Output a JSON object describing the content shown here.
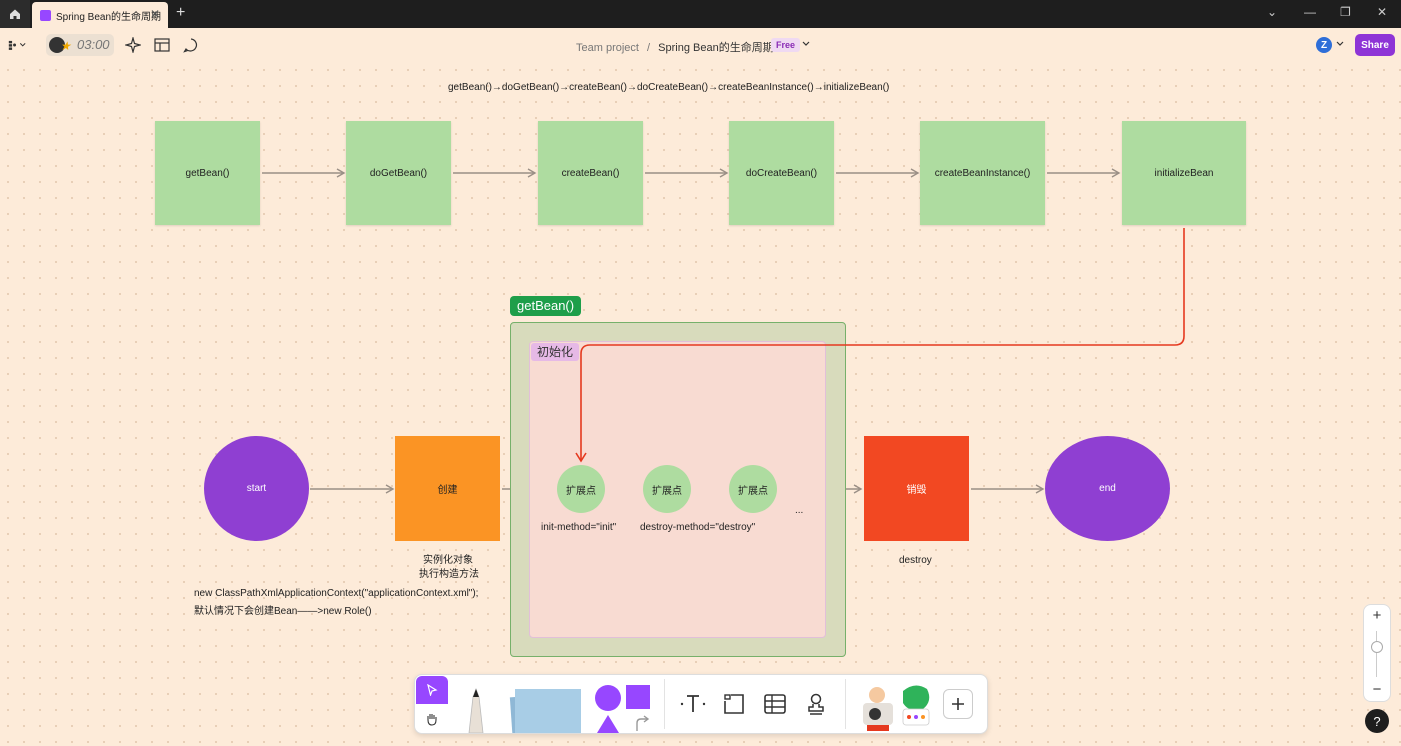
{
  "window": {
    "tab_title": "Spring Bean的生命周期",
    "tab_close": "✕",
    "new_tab": "+",
    "controls": [
      "⌄",
      "—",
      "❐",
      "✕"
    ]
  },
  "toolbar": {
    "timer": "03:00",
    "breadcrumb_team": "Team project",
    "breadcrumb_sep": "/",
    "file_name": "Spring Bean的生命周期",
    "plan_badge": "Free",
    "user_initial": "Z",
    "share_label": "Share"
  },
  "canvas": {
    "chain_text": "getBean()→doGetBean()→createBean()→doCreateBean()→createBeanInstance()→initializeBean()",
    "top_flow": [
      "getBean()",
      "doGetBean()",
      "createBean()",
      "doCreateBean()",
      "createBeanInstance()",
      "initializeBean"
    ],
    "section_title": "getBean()",
    "init_section_title": "初始化",
    "start_label": "start",
    "create_label": "创建",
    "extension_labels": [
      "扩展点",
      "扩展点",
      "扩展点"
    ],
    "ellipsis": "...",
    "destroy_label": "销毁",
    "end_label": "end",
    "init_method_text": "init-method=\"init\"",
    "destroy_method_text": "destroy-method=\"destroy\"",
    "create_note_1": "实例化对象",
    "create_note_2": "执行构造方法",
    "destroy_note": "destroy",
    "context_note_1": "new ClassPathXmlApplicationContext(\"applicationContext.xml\");",
    "context_note_2": "默认情况下会创建Bean——>new Role()"
  },
  "zoom": {
    "plus": "+",
    "minus": "−"
  },
  "help": "?",
  "colors": {
    "sticky_green": "#aedca0",
    "purple": "#8f3fd2",
    "orange": "#fb9424",
    "red": "#f24822",
    "accent": "#8e34d6"
  }
}
